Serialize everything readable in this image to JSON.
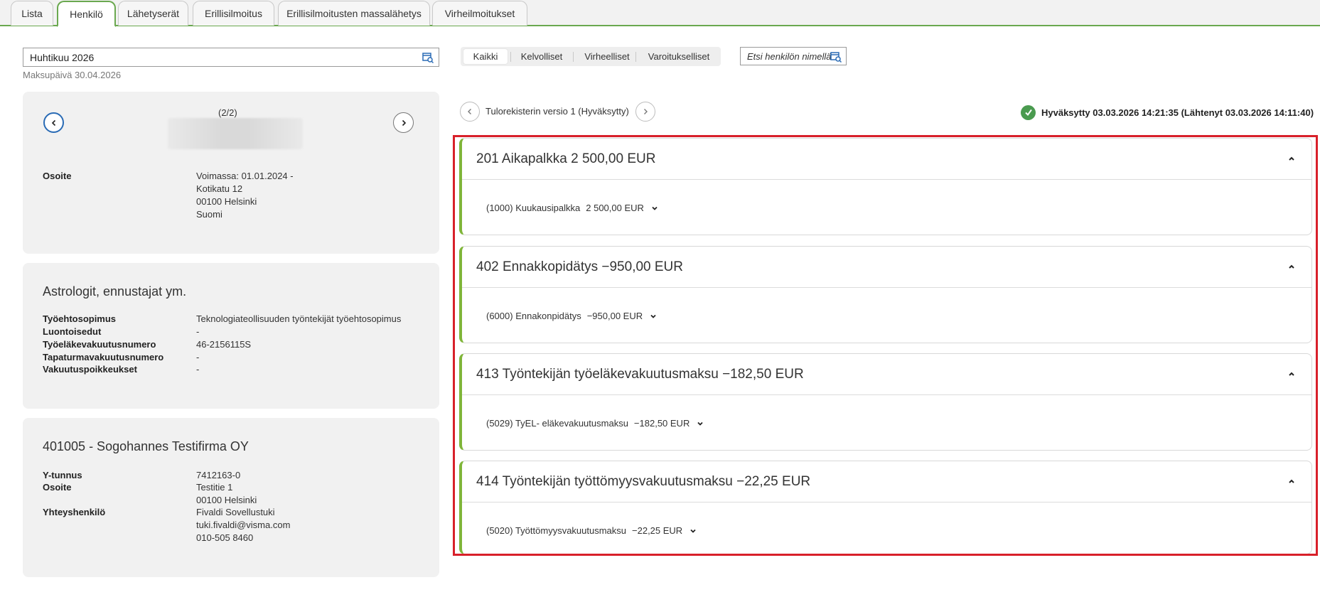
{
  "tabs": [
    {
      "label": "Lista",
      "active": false
    },
    {
      "label": "Henkilö",
      "active": true
    },
    {
      "label": "Lähetyserät",
      "active": false
    },
    {
      "label": "Erillisilmoitus",
      "active": false
    },
    {
      "label": "Erillisilmoitusten massalähetys",
      "active": false
    },
    {
      "label": "Virheilmoitukset",
      "active": false
    }
  ],
  "period": {
    "value": "Huhtikuu 2026",
    "payday": "Maksupäivä 30.04.2026"
  },
  "filters": [
    "Kaikki",
    "Kelvolliset",
    "Virheelliset",
    "Varoitukselliset"
  ],
  "name_search": {
    "placeholder": "Etsi henkilön nimellä"
  },
  "person_card": {
    "pager": "(2/2)",
    "address_label": "Osoite",
    "address_lines": [
      "Voimassa: 01.01.2024 -",
      "Kotikatu 12",
      "00100 Helsinki",
      "Suomi"
    ]
  },
  "occupation_card": {
    "title": "Astrologit, ennustajat ym.",
    "rows": [
      {
        "label": "Työehtosopimus",
        "value": "Teknologiateollisuuden työntekijät työehtosopimus"
      },
      {
        "label": "Luontoisedut",
        "value": "-"
      },
      {
        "label": "Työeläkevakuutusnumero",
        "value": "46-2156115S"
      },
      {
        "label": "Tapaturmavakuutusnumero",
        "value": "-"
      },
      {
        "label": "Vakuutuspoikkeukset",
        "value": "-"
      }
    ]
  },
  "company_card": {
    "title": "401005 - Sogohannes Testifirma OY",
    "ytunnus_label": "Y-tunnus",
    "ytunnus": "7412163-0",
    "address_label": "Osoite",
    "address_lines": [
      "Testitie 1",
      "00100 Helsinki"
    ],
    "contact_label": "Yhteyshenkilö",
    "contact_lines": [
      "Fivaldi Sovellustuki",
      "tuki.fivaldi@visma.com",
      "010-505 8460"
    ]
  },
  "version": {
    "label": "Tulorekisterin versio 1 (Hyväksytty)",
    "status": "Hyväksytty 03.03.2026 14:21:35 (Lähtenyt 03.03.2026 14:11:40)"
  },
  "income_items": [
    {
      "title": "201 Aikapalkka 2 500,00 EUR",
      "row_label": "(1000) Kuukausipalkka",
      "row_amount": "2 500,00 EUR"
    },
    {
      "title": "402 Ennakkopidätys −950,00 EUR",
      "row_label": "(6000) Ennakonpidätys",
      "row_amount": "−950,00 EUR"
    },
    {
      "title": "413 Työntekijän työeläkevakuutusmaksu −182,50 EUR",
      "row_label": "(5029) TyEL- eläkevakuutusmaksu",
      "row_amount": "−182,50 EUR"
    },
    {
      "title": "414 Työntekijän työttömyysvakuutusmaksu −22,25 EUR",
      "row_label": "(5020) Työttömyysvakuutusmaksu",
      "row_amount": "−22,25 EUR"
    }
  ],
  "colors": {
    "accent_green": "#6aa84f",
    "panel_border_green": "#7fb539",
    "highlight_red": "#d8202a",
    "ok_green": "#4a9b4f",
    "nav_blue": "#2a6bb5"
  }
}
